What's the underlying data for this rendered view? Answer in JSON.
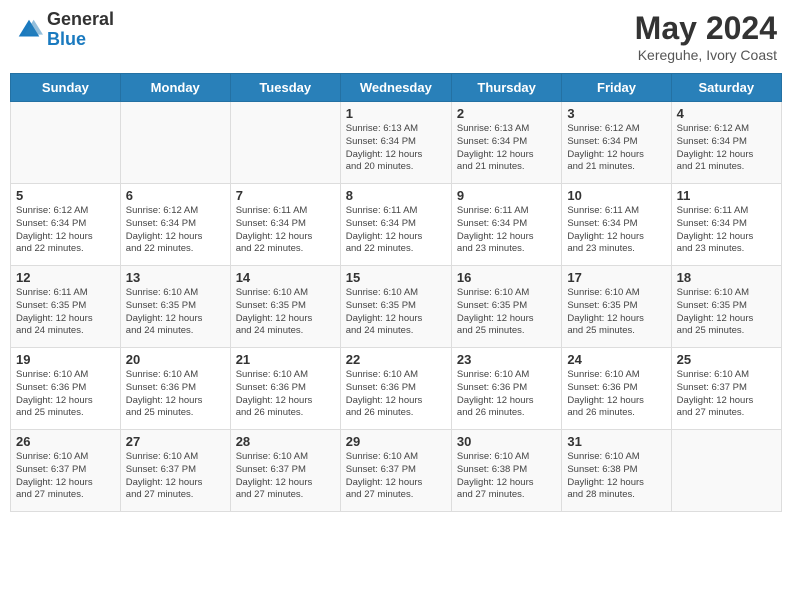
{
  "header": {
    "logo_general": "General",
    "logo_blue": "Blue",
    "month_title": "May 2024",
    "location": "Kereguhe, Ivory Coast"
  },
  "days_of_week": [
    "Sunday",
    "Monday",
    "Tuesday",
    "Wednesday",
    "Thursday",
    "Friday",
    "Saturday"
  ],
  "weeks": [
    [
      {
        "day": "",
        "info": ""
      },
      {
        "day": "",
        "info": ""
      },
      {
        "day": "",
        "info": ""
      },
      {
        "day": "1",
        "info": "Sunrise: 6:13 AM\nSunset: 6:34 PM\nDaylight: 12 hours\nand 20 minutes."
      },
      {
        "day": "2",
        "info": "Sunrise: 6:13 AM\nSunset: 6:34 PM\nDaylight: 12 hours\nand 21 minutes."
      },
      {
        "day": "3",
        "info": "Sunrise: 6:12 AM\nSunset: 6:34 PM\nDaylight: 12 hours\nand 21 minutes."
      },
      {
        "day": "4",
        "info": "Sunrise: 6:12 AM\nSunset: 6:34 PM\nDaylight: 12 hours\nand 21 minutes."
      }
    ],
    [
      {
        "day": "5",
        "info": "Sunrise: 6:12 AM\nSunset: 6:34 PM\nDaylight: 12 hours\nand 22 minutes."
      },
      {
        "day": "6",
        "info": "Sunrise: 6:12 AM\nSunset: 6:34 PM\nDaylight: 12 hours\nand 22 minutes."
      },
      {
        "day": "7",
        "info": "Sunrise: 6:11 AM\nSunset: 6:34 PM\nDaylight: 12 hours\nand 22 minutes."
      },
      {
        "day": "8",
        "info": "Sunrise: 6:11 AM\nSunset: 6:34 PM\nDaylight: 12 hours\nand 22 minutes."
      },
      {
        "day": "9",
        "info": "Sunrise: 6:11 AM\nSunset: 6:34 PM\nDaylight: 12 hours\nand 23 minutes."
      },
      {
        "day": "10",
        "info": "Sunrise: 6:11 AM\nSunset: 6:34 PM\nDaylight: 12 hours\nand 23 minutes."
      },
      {
        "day": "11",
        "info": "Sunrise: 6:11 AM\nSunset: 6:34 PM\nDaylight: 12 hours\nand 23 minutes."
      }
    ],
    [
      {
        "day": "12",
        "info": "Sunrise: 6:11 AM\nSunset: 6:35 PM\nDaylight: 12 hours\nand 24 minutes."
      },
      {
        "day": "13",
        "info": "Sunrise: 6:10 AM\nSunset: 6:35 PM\nDaylight: 12 hours\nand 24 minutes."
      },
      {
        "day": "14",
        "info": "Sunrise: 6:10 AM\nSunset: 6:35 PM\nDaylight: 12 hours\nand 24 minutes."
      },
      {
        "day": "15",
        "info": "Sunrise: 6:10 AM\nSunset: 6:35 PM\nDaylight: 12 hours\nand 24 minutes."
      },
      {
        "day": "16",
        "info": "Sunrise: 6:10 AM\nSunset: 6:35 PM\nDaylight: 12 hours\nand 25 minutes."
      },
      {
        "day": "17",
        "info": "Sunrise: 6:10 AM\nSunset: 6:35 PM\nDaylight: 12 hours\nand 25 minutes."
      },
      {
        "day": "18",
        "info": "Sunrise: 6:10 AM\nSunset: 6:35 PM\nDaylight: 12 hours\nand 25 minutes."
      }
    ],
    [
      {
        "day": "19",
        "info": "Sunrise: 6:10 AM\nSunset: 6:36 PM\nDaylight: 12 hours\nand 25 minutes."
      },
      {
        "day": "20",
        "info": "Sunrise: 6:10 AM\nSunset: 6:36 PM\nDaylight: 12 hours\nand 25 minutes."
      },
      {
        "day": "21",
        "info": "Sunrise: 6:10 AM\nSunset: 6:36 PM\nDaylight: 12 hours\nand 26 minutes."
      },
      {
        "day": "22",
        "info": "Sunrise: 6:10 AM\nSunset: 6:36 PM\nDaylight: 12 hours\nand 26 minutes."
      },
      {
        "day": "23",
        "info": "Sunrise: 6:10 AM\nSunset: 6:36 PM\nDaylight: 12 hours\nand 26 minutes."
      },
      {
        "day": "24",
        "info": "Sunrise: 6:10 AM\nSunset: 6:36 PM\nDaylight: 12 hours\nand 26 minutes."
      },
      {
        "day": "25",
        "info": "Sunrise: 6:10 AM\nSunset: 6:37 PM\nDaylight: 12 hours\nand 27 minutes."
      }
    ],
    [
      {
        "day": "26",
        "info": "Sunrise: 6:10 AM\nSunset: 6:37 PM\nDaylight: 12 hours\nand 27 minutes."
      },
      {
        "day": "27",
        "info": "Sunrise: 6:10 AM\nSunset: 6:37 PM\nDaylight: 12 hours\nand 27 minutes."
      },
      {
        "day": "28",
        "info": "Sunrise: 6:10 AM\nSunset: 6:37 PM\nDaylight: 12 hours\nand 27 minutes."
      },
      {
        "day": "29",
        "info": "Sunrise: 6:10 AM\nSunset: 6:37 PM\nDaylight: 12 hours\nand 27 minutes."
      },
      {
        "day": "30",
        "info": "Sunrise: 6:10 AM\nSunset: 6:38 PM\nDaylight: 12 hours\nand 27 minutes."
      },
      {
        "day": "31",
        "info": "Sunrise: 6:10 AM\nSunset: 6:38 PM\nDaylight: 12 hours\nand 28 minutes."
      },
      {
        "day": "",
        "info": ""
      }
    ]
  ]
}
